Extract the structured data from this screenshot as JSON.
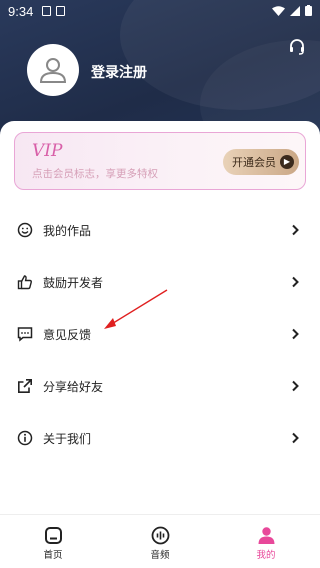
{
  "status_bar": {
    "time": "9:34"
  },
  "profile": {
    "login_label": "登录注册"
  },
  "vip": {
    "title": "VIP",
    "subtitle": "点击会员标志，享更多特权",
    "button_label": "开通会员"
  },
  "menu": [
    {
      "label": "我的作品",
      "icon": "smiley-icon"
    },
    {
      "label": "鼓励开发者",
      "icon": "thumbs-up-icon"
    },
    {
      "label": "意见反馈",
      "icon": "feedback-icon"
    },
    {
      "label": "分享给好友",
      "icon": "share-icon"
    },
    {
      "label": "关于我们",
      "icon": "info-icon"
    }
  ],
  "tabs": [
    {
      "label": "首页",
      "icon": "home-icon",
      "active": false
    },
    {
      "label": "音频",
      "icon": "audio-icon",
      "active": false
    },
    {
      "label": "我的",
      "icon": "profile-icon",
      "active": true
    }
  ],
  "colors": {
    "header": "#243456",
    "accent": "#e8489a",
    "vip_pink": "#d85fa8",
    "annotation_arrow": "#e02020"
  }
}
